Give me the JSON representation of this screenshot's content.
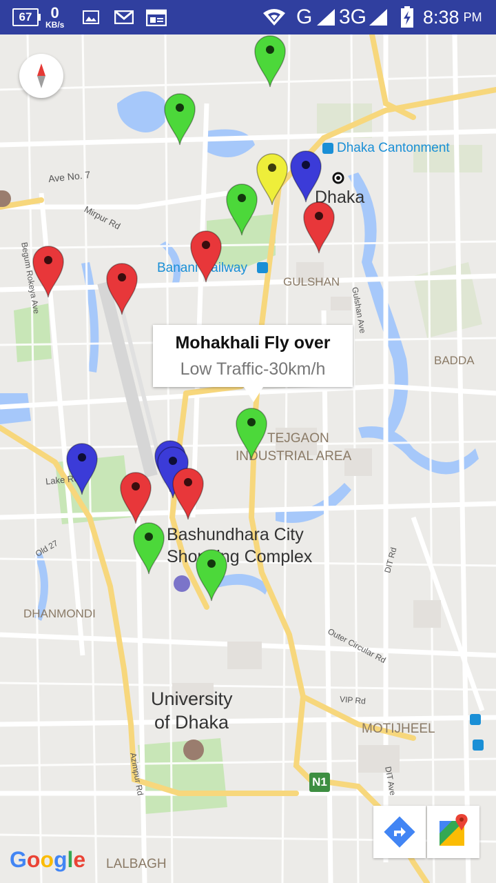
{
  "status_bar": {
    "battery_level": "67",
    "net_speed_value": "0",
    "net_speed_unit": "KB/s",
    "network_type": "G",
    "network_type2": "3G",
    "time": "8:38",
    "ampm": "PM",
    "icons": [
      "battery-percent-icon",
      "image-notification-icon",
      "gmail-icon",
      "calendar-notification-icon",
      "wifi-hotspot-icon",
      "signal-icon",
      "signal-3g-icon",
      "charging-battery-icon"
    ]
  },
  "map": {
    "places": {
      "dhaka_cantonment": "Dhaka Cantonment",
      "dhaka": "Dhaka",
      "ave_no": "Ave No. 7",
      "mirpur_rd": "Mirpur Rd",
      "begum_rd": "Begum Rokeya Ave",
      "banani_railway": "Banani Railway",
      "gulshan": "GULSHAN",
      "gulshan_ave": "Gulshan Ave",
      "badda": "BADDA",
      "tejgaon1": "TEJGAON",
      "tejgaon2": "INDUSTRIAL AREA",
      "lake_rd": "Lake Rd",
      "bashundhara1": "Bashundhara City",
      "bashundhara2": "Shopping Complex",
      "dit_rd": "DIT Rd",
      "old27": "Old 27",
      "dhanmondi": "DHANMONDI",
      "outer_circular": "Outer Circular Rd",
      "university1": "University",
      "university2": "of Dhaka",
      "vip_rd": "VIP Rd",
      "motijheel": "MOTIJHEEL",
      "azimpur": "Azimpur Rd",
      "dit_ave": "DIT Ave",
      "n1": "N1",
      "lalbagh": "LALBAGH"
    },
    "info_window": {
      "title": "Mohakhali Fly over",
      "snippet": "Low Traffic-30km/h"
    },
    "marker_colors": {
      "green": "#4cd83a",
      "red": "#e8373a",
      "blue": "#3b3bd8",
      "yellow": "#eeee3a"
    },
    "markers": [
      {
        "status": "green",
        "name": "marker-green"
      },
      {
        "status": "green",
        "name": "marker-green"
      },
      {
        "status": "yellow",
        "name": "marker-yellow"
      },
      {
        "status": "blue",
        "name": "marker-blue"
      },
      {
        "status": "green",
        "name": "marker-green"
      },
      {
        "status": "red",
        "name": "marker-red"
      },
      {
        "status": "red",
        "name": "marker-red"
      },
      {
        "status": "red",
        "name": "marker-red"
      },
      {
        "status": "red",
        "name": "marker-red"
      },
      {
        "status": "green",
        "name": "marker-green-selected"
      },
      {
        "status": "blue",
        "name": "marker-blue"
      },
      {
        "status": "blue",
        "name": "marker-blue"
      },
      {
        "status": "blue",
        "name": "marker-blue"
      },
      {
        "status": "red",
        "name": "marker-red"
      },
      {
        "status": "red",
        "name": "marker-red"
      },
      {
        "status": "green",
        "name": "marker-green"
      },
      {
        "status": "green",
        "name": "marker-green"
      }
    ],
    "attribution": "Google",
    "toolbar": [
      "directions-icon",
      "google-maps-icon"
    ]
  }
}
